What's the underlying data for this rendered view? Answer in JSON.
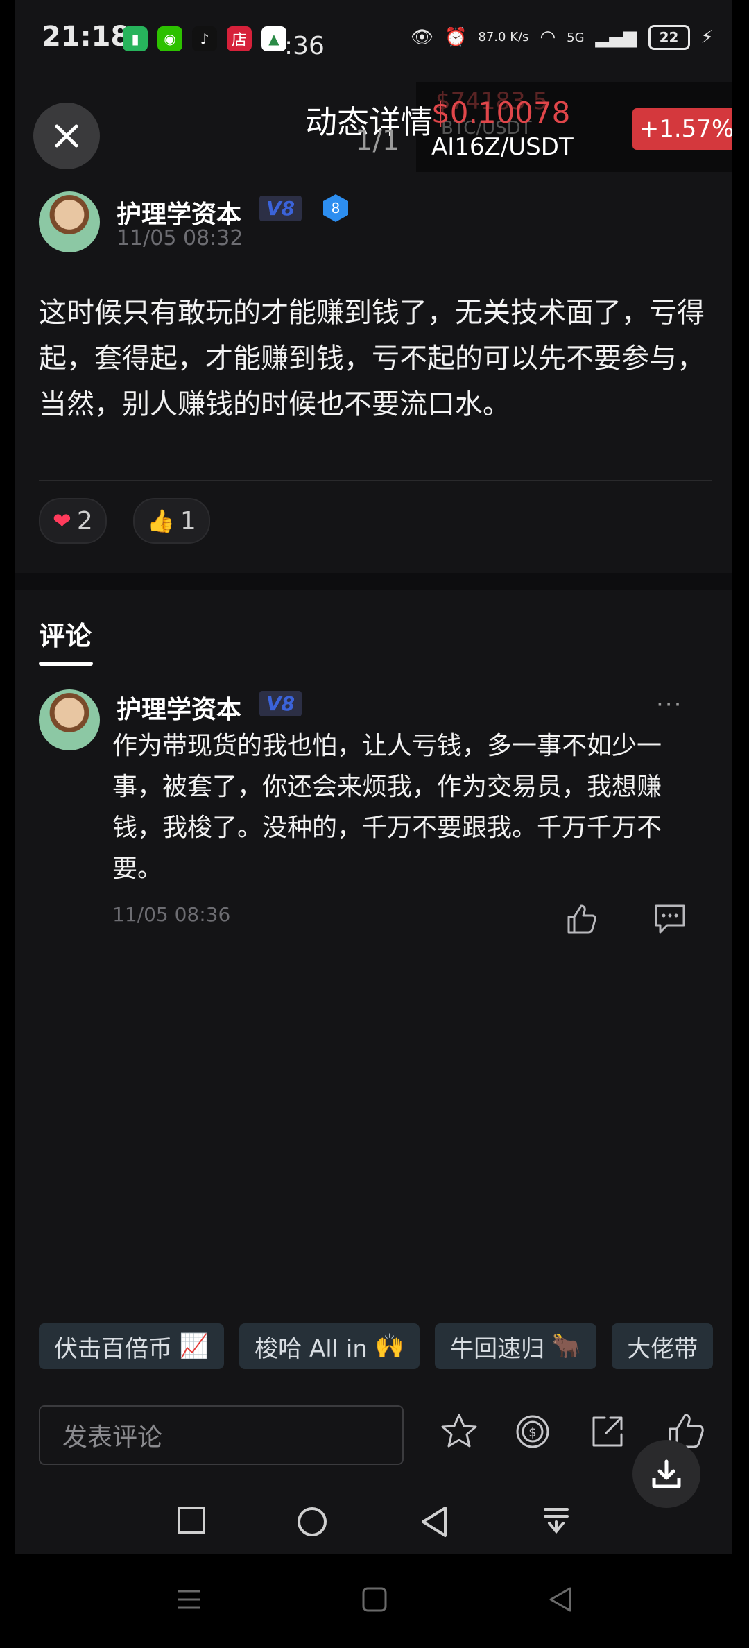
{
  "status_bar": {
    "time": "21:18",
    "clock_overlay": ":36",
    "net_speed": "87.0 K/s",
    "network": "5G",
    "battery": "22"
  },
  "ticker": {
    "ghost_price": "$74183.5",
    "ghost_pair": "BTC/USDT",
    "price": "$0.10078",
    "pair": "AI16Z/USDT",
    "change": "+1.57%"
  },
  "header": {
    "title": "动态详情",
    "counter": "1/1"
  },
  "post": {
    "author": "护理学资本",
    "vip": "V8",
    "level": "8",
    "time": "11/05 08:32",
    "body": "这时候只有敢玩的才能赚到钱了，无关技术面了，亏得起，套得起，才能赚到钱，亏不起的可以先不要参与，当然，别人赚钱的时候也不要流口水。",
    "reactions": [
      {
        "icon": "heart-icon",
        "count": "2"
      },
      {
        "icon": "thumbs-up-icon",
        "count": "1"
      }
    ]
  },
  "comments": {
    "tab_label": "评论",
    "items": [
      {
        "author": "护理学资本",
        "vip": "V8",
        "more": "···",
        "body": "作为带现货的我也怕，让人亏钱，多一事不如少一事，被套了，你还会来烦我，作为交易员，我想赚钱，我梭了。没种的，千万不要跟我。千万千万不要。",
        "time": "11/05 08:36"
      }
    ]
  },
  "quick_chips": [
    {
      "text": "伏击百倍币",
      "emoji": "📈"
    },
    {
      "text": "梭哈 All in",
      "emoji": "🙌"
    },
    {
      "text": "牛回速归",
      "emoji": "🐂"
    },
    {
      "text": "大佬带",
      "emoji": ""
    }
  ],
  "composer": {
    "placeholder": "发表评论"
  },
  "colors": {
    "accent_red": "#d4383d",
    "vip_blue": "#3b63d9",
    "background": "#141416"
  }
}
